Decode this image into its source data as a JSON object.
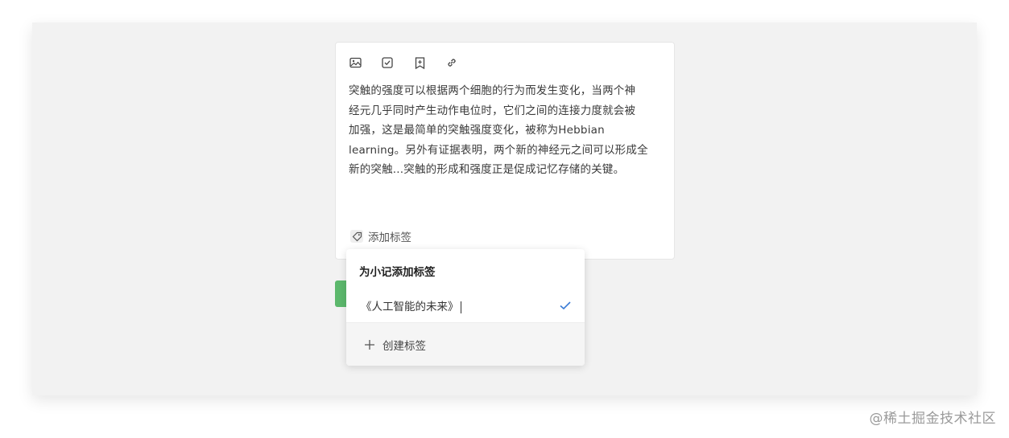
{
  "toolbar": {
    "icons": [
      "image-icon",
      "checkbox-icon",
      "bookmark-icon",
      "link-icon"
    ]
  },
  "note": {
    "lines": [
      "突触的强度可以根据两个细胞的行为而发生变化，当两个神",
      "经元几乎同时产生动作电位时，它们之间的连接力度就会被",
      "加强，这是最简单的突触强度变化，被称为Hebbian",
      "learning。另外有证据表明，两个新的神经元之间可以形成全",
      "新的突触...突触的形成和强度正是促成记忆存储的关键。"
    ]
  },
  "tag_trigger": {
    "label": "添加标签"
  },
  "popover": {
    "title": "为小记添加标签",
    "option": {
      "name": "《人工智能的未来》",
      "selected": true
    },
    "create_label": "创建标签"
  },
  "watermark": "@稀土掘金技术社区",
  "colors": {
    "accent_check": "#3a7bd5",
    "green_button": "#5cb86c",
    "canvas_bg": "#f2f2f2"
  }
}
